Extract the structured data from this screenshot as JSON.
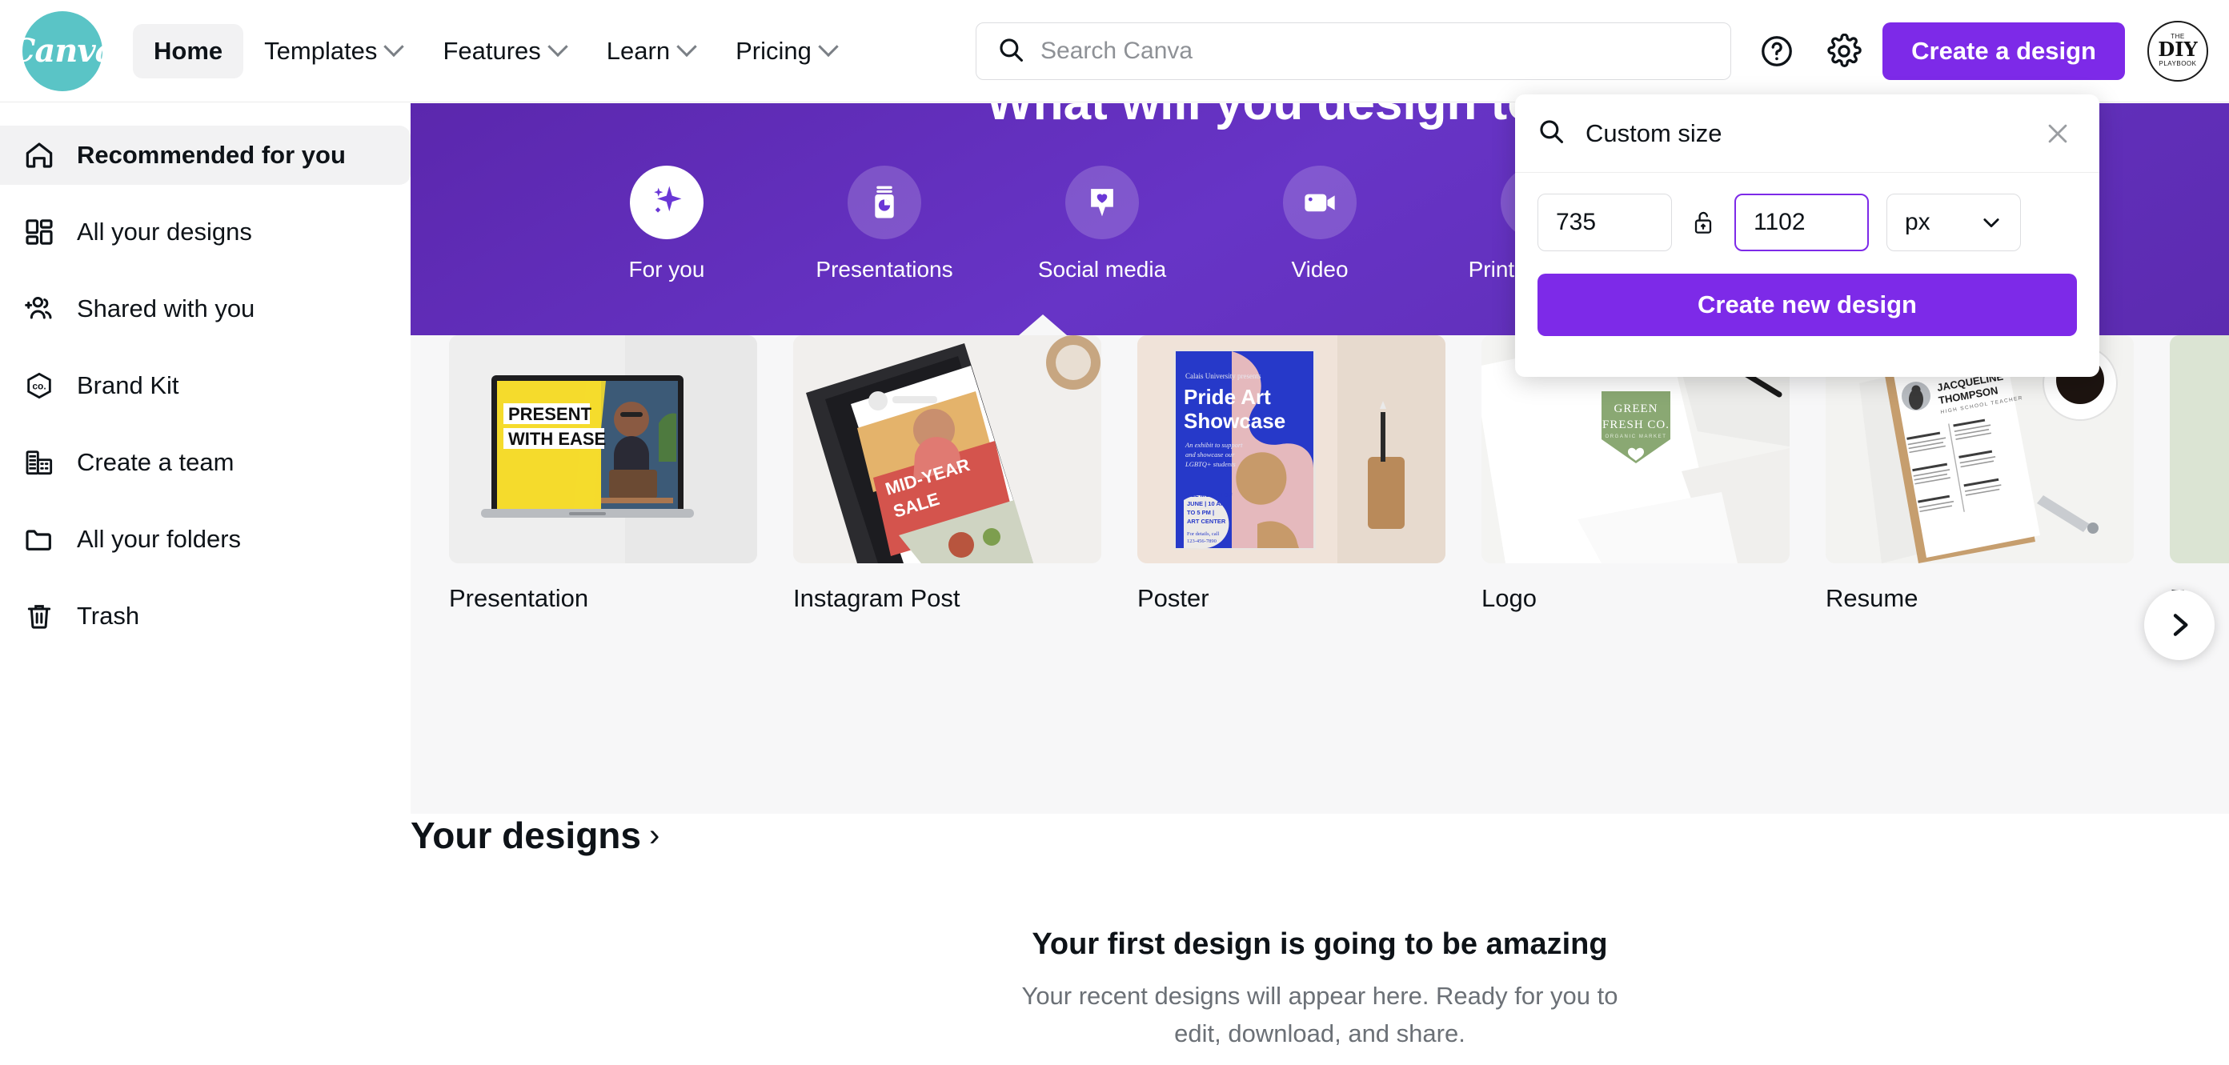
{
  "brand": {
    "name": "Canva",
    "accent": "#7d2ae8",
    "logo_bg": "#5ac4c6"
  },
  "header": {
    "nav": [
      {
        "label": "Home",
        "active": true,
        "caret": false
      },
      {
        "label": "Templates",
        "active": false,
        "caret": true
      },
      {
        "label": "Features",
        "active": false,
        "caret": true
      },
      {
        "label": "Learn",
        "active": false,
        "caret": true
      },
      {
        "label": "Pricing",
        "active": false,
        "caret": true
      }
    ],
    "search": {
      "placeholder": "Search Canva",
      "value": "",
      "icon": "search-icon"
    },
    "help_icon": "help-circle-icon",
    "settings_icon": "gear-icon",
    "cta_label": "Create a design",
    "avatar": {
      "line1": "THE",
      "line2": "DIY",
      "line3": "PLAYBOOK"
    }
  },
  "sidebar": {
    "items": [
      {
        "label": "Recommended for you",
        "icon": "home-icon",
        "active": true
      },
      {
        "label": "All your designs",
        "icon": "grid-icon",
        "active": false
      },
      {
        "label": "Shared with you",
        "icon": "people-add-icon",
        "active": false
      },
      {
        "label": "Brand Kit",
        "icon": "brand-hexagon-icon",
        "active": false
      },
      {
        "label": "Create a team",
        "icon": "building-icon",
        "active": false
      },
      {
        "label": "All your folders",
        "icon": "folder-icon",
        "active": false
      },
      {
        "label": "Trash",
        "icon": "trash-icon",
        "active": false
      }
    ]
  },
  "banner": {
    "heading": "What will you design today?",
    "categories": [
      {
        "label": "For you",
        "icon": "sparkle-icon",
        "active": true
      },
      {
        "label": "Presentations",
        "icon": "presentation-icon",
        "active": false
      },
      {
        "label": "Social media",
        "icon": "heart-pin-icon",
        "active": false
      },
      {
        "label": "Video",
        "icon": "video-camera-icon",
        "active": false
      },
      {
        "label": "Print products",
        "icon": "print-products-icon",
        "active": false
      }
    ]
  },
  "cards": [
    {
      "title": "Presentation",
      "thumb": "presentation-thumb",
      "thumb_text": {
        "line1": "PRESENT",
        "line2": "WITH EASE"
      }
    },
    {
      "title": "Instagram Post",
      "thumb": "instagram-post-thumb",
      "thumb_text": {
        "line1": "MID-YEAR",
        "line2": "SALE"
      }
    },
    {
      "title": "Poster",
      "thumb": "poster-thumb",
      "thumb_text": {
        "eyebrow": "Calais University presents",
        "line1": "Pride Art",
        "line2": "Showcase",
        "body": "An exhibit to support and showcase our LGBTQ+ students",
        "details": "ALL MONTH OF JUNE | 10 AM TO 5 PM | ART CENTER",
        "phone": "For details, call 123-456-7890"
      }
    },
    {
      "title": "Logo",
      "thumb": "logo-thumb",
      "thumb_text": {
        "line1": "GREEN",
        "line2": "FRESH CO.",
        "line3": "ORGANIC MARKET"
      }
    },
    {
      "title": "Resume",
      "thumb": "resume-thumb",
      "thumb_text": {
        "line1": "JACQUELINE",
        "line2": "THOMPSON",
        "line3": "HIGH SCHOOL TEACHER"
      }
    },
    {
      "title": "F",
      "thumb": "flyer-thumb",
      "thumb_text": {}
    }
  ],
  "carousel": {
    "next_icon": "chevron-right-icon"
  },
  "designs": {
    "heading": "Your designs",
    "heading_arrow": "›",
    "empty_title": "Your first design is going to be amazing",
    "empty_sub": "Your recent designs will appear here. Ready for you to edit, download, and share."
  },
  "custom_size_panel": {
    "search_icon": "search-icon",
    "title": "Custom size",
    "close_icon": "close-icon",
    "width_value": "735",
    "lock_icon": "unlock-icon",
    "height_value": "1102",
    "height_focused": true,
    "unit_value": "px",
    "unit_caret": "chevron-down-icon",
    "submit_label": "Create new design"
  }
}
